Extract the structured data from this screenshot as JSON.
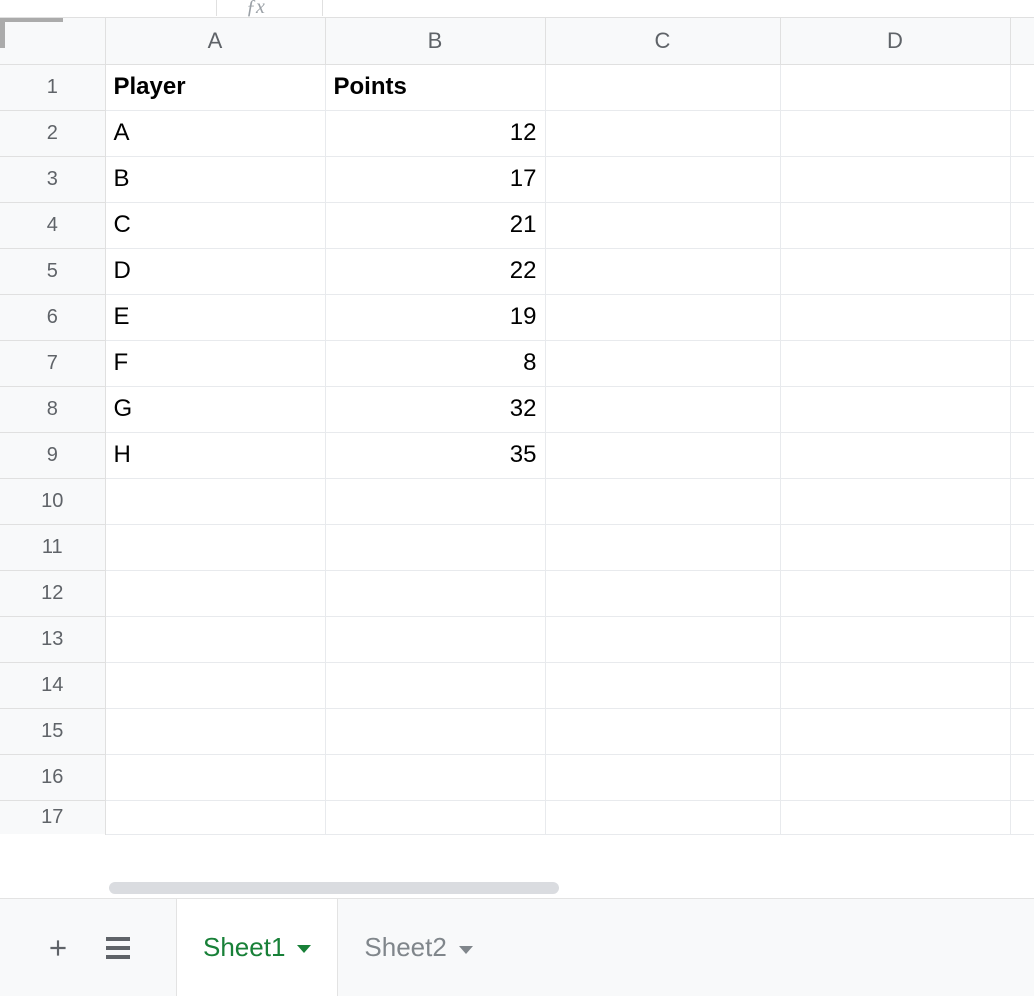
{
  "columns": [
    "A",
    "B",
    "C",
    "D"
  ],
  "row_numbers": [
    1,
    2,
    3,
    4,
    5,
    6,
    7,
    8,
    9,
    10,
    11,
    12,
    13,
    14,
    15,
    16,
    17
  ],
  "headers": {
    "A": "Player",
    "B": "Points"
  },
  "rows": [
    {
      "player": "A",
      "points": 12
    },
    {
      "player": "B",
      "points": 17
    },
    {
      "player": "C",
      "points": 21
    },
    {
      "player": "D",
      "points": 22
    },
    {
      "player": "E",
      "points": 19
    },
    {
      "player": "F",
      "points": 8
    },
    {
      "player": "G",
      "points": 32
    },
    {
      "player": "H",
      "points": 35
    }
  ],
  "tabs": {
    "active": "Sheet1",
    "inactive": "Sheet2"
  },
  "chart_data": {
    "type": "table",
    "title": "",
    "columns": [
      "Player",
      "Points"
    ],
    "records": [
      [
        "A",
        12
      ],
      [
        "B",
        17
      ],
      [
        "C",
        21
      ],
      [
        "D",
        22
      ],
      [
        "E",
        19
      ],
      [
        "F",
        8
      ],
      [
        "G",
        32
      ],
      [
        "H",
        35
      ]
    ]
  }
}
